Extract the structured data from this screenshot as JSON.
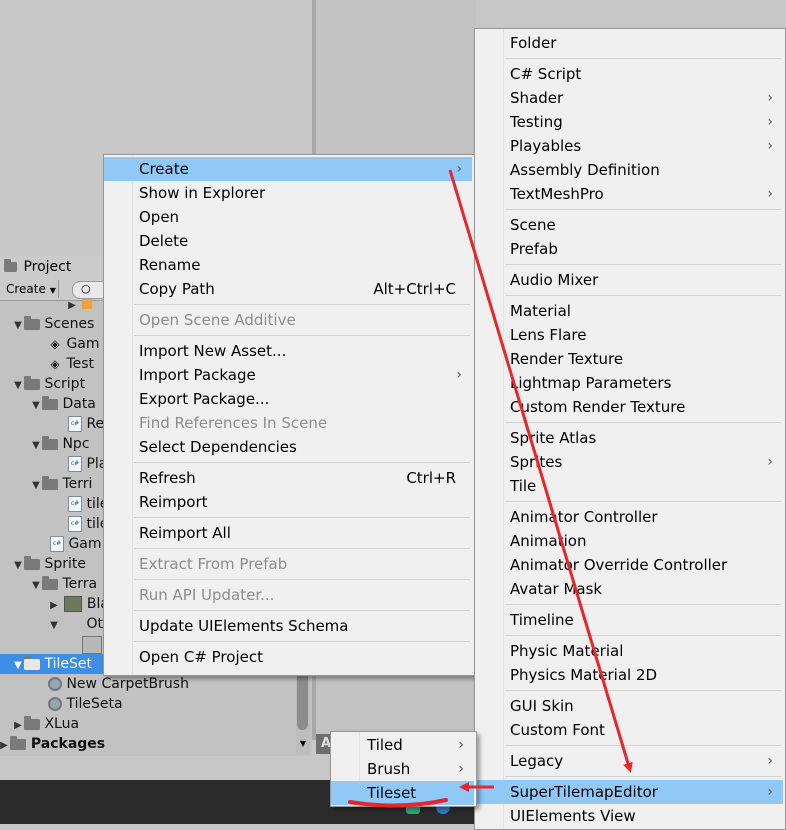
{
  "project_panel": {
    "tab_label": "Project",
    "create_label": "Create",
    "tree": {
      "scenes": "Scenes",
      "scene_game": "Gam",
      "scene_test": "Test",
      "script": "Script",
      "data": "Data",
      "data_file": "Re",
      "npc": "Npc",
      "npc_file": "Pla",
      "terrain": "Terri",
      "terrain_file1": "tile",
      "terrain_file2": "tile",
      "game_file": "Gam",
      "sprite": "Sprite",
      "sprite_terrain": "Terra",
      "sprite_bla": "Bla",
      "sprite_ot": "Ot",
      "tileset": "TileSet",
      "new_carpet_brush": "New CarpetBrush",
      "tileseta": "TileSeta",
      "xlua": "XLua",
      "packages": "Packages"
    },
    "bottom_fragment": "A"
  },
  "context_menu": {
    "items": [
      {
        "label": "Create",
        "submenu": true
      },
      {
        "label": "Show in Explorer"
      },
      {
        "label": "Open"
      },
      {
        "label": "Delete"
      },
      {
        "label": "Rename"
      },
      {
        "label": "Copy Path",
        "shortcut": "Alt+Ctrl+C"
      },
      {
        "label": "Open Scene Additive"
      },
      {
        "label": "Import New Asset..."
      },
      {
        "label": "Import Package",
        "submenu": true
      },
      {
        "label": "Export Package..."
      },
      {
        "label": "Find References In Scene"
      },
      {
        "label": "Select Dependencies"
      },
      {
        "label": "Refresh",
        "shortcut": "Ctrl+R"
      },
      {
        "label": "Reimport"
      },
      {
        "label": "Reimport All"
      },
      {
        "label": "Extract From Prefab"
      },
      {
        "label": "Run API Updater..."
      },
      {
        "label": "Update UIElements Schema"
      },
      {
        "label": "Open C# Project"
      }
    ],
    "arrow_glyph": "›"
  },
  "create_submenu": {
    "items": [
      {
        "label": "Folder"
      },
      {
        "label": "C# Script"
      },
      {
        "label": "Shader"
      },
      {
        "label": "Testing"
      },
      {
        "label": "Playables"
      },
      {
        "label": "Assembly Definition"
      },
      {
        "label": "TextMeshPro"
      },
      {
        "label": "Scene"
      },
      {
        "label": "Prefab"
      },
      {
        "label": "Audio Mixer"
      },
      {
        "label": "Material"
      },
      {
        "label": "Lens Flare"
      },
      {
        "label": "Render Texture"
      },
      {
        "label": "Lightmap Parameters"
      },
      {
        "label": "Custom Render Texture"
      },
      {
        "label": "Sprite Atlas"
      },
      {
        "label": "Sprites"
      },
      {
        "label": "Tile"
      },
      {
        "label": "Animator Controller"
      },
      {
        "label": "Animation"
      },
      {
        "label": "Animator Override Controller"
      },
      {
        "label": "Avatar Mask"
      },
      {
        "label": "Timeline"
      },
      {
        "label": "Physic Material"
      },
      {
        "label": "Physics Material 2D"
      },
      {
        "label": "GUI Skin"
      },
      {
        "label": "Custom Font"
      },
      {
        "label": "Legacy"
      },
      {
        "label": "SuperTilemapEditor"
      },
      {
        "label": "UIElements View"
      }
    ]
  },
  "super_tilemap_submenu": {
    "items": [
      {
        "label": "Tiled"
      },
      {
        "label": "Brush"
      },
      {
        "label": "Tileset"
      }
    ]
  },
  "colors": {
    "highlight": "#90c8f6",
    "selection": "#3d8ee6",
    "annotation_red": "#e8252b"
  }
}
